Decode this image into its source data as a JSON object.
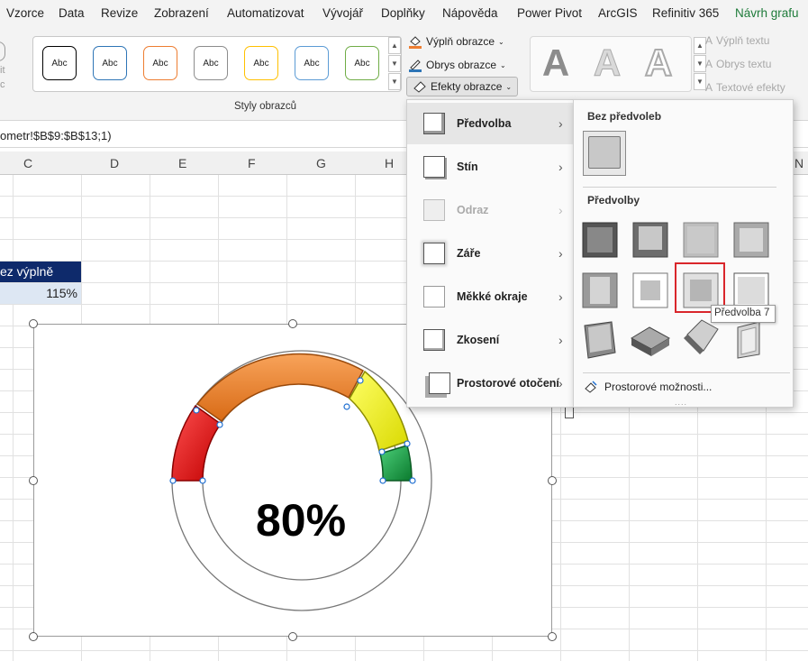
{
  "tabs": [
    "Vzorce",
    "Data",
    "Revize",
    "Zobrazení",
    "Automatizovat",
    "Vývojář",
    "Doplňky",
    "Nápověda",
    "Power Pivot",
    "ArcGIS",
    "Refinitiv 365",
    "Návrh grafu"
  ],
  "ribbon": {
    "style_swatch_text": "Abc",
    "style_colors": [
      "#000000",
      "#2e75b6",
      "#ed7d31",
      "#8c8c8c",
      "#ffc000",
      "#5b9bd5",
      "#70ad47"
    ],
    "group_label": "Styly obrazců",
    "fill_label": "Výplň obrazce",
    "outline_label": "Obrys obrazce",
    "effects_label": "Efekty obrazce",
    "wordart_letter": "A",
    "text_fill_label": "Výplň textu",
    "text_outline_label": "Obrys textu",
    "text_effects_label": "Textové efekty",
    "left_cut_1": "it",
    "left_cut_2": "c"
  },
  "formula": "ometr!$B$9:$B$13;1)",
  "columns": [
    "C",
    "D",
    "E",
    "F",
    "G",
    "H",
    "N"
  ],
  "cells": {
    "header": "ez výplně",
    "value": "115%"
  },
  "chart": {
    "center_label": "80%",
    "segments": [
      "red",
      "orange",
      "yellow",
      "green"
    ]
  },
  "effects_menu": [
    {
      "label": "Předvolba",
      "disabled": false
    },
    {
      "label": "Stín",
      "disabled": false
    },
    {
      "label": "Odraz",
      "disabled": true
    },
    {
      "label": "Záře",
      "disabled": false
    },
    {
      "label": "Měkké okraje",
      "disabled": false
    },
    {
      "label": "Zkosení",
      "disabled": false
    },
    {
      "label": "Prostorové otočení",
      "disabled": false
    }
  ],
  "submenu": {
    "no_presets_header": "Bez předvoleb",
    "presets_header": "Předvolby",
    "more_options": "Prostorové možnosti...",
    "tooltip": "Předvolba 7"
  }
}
